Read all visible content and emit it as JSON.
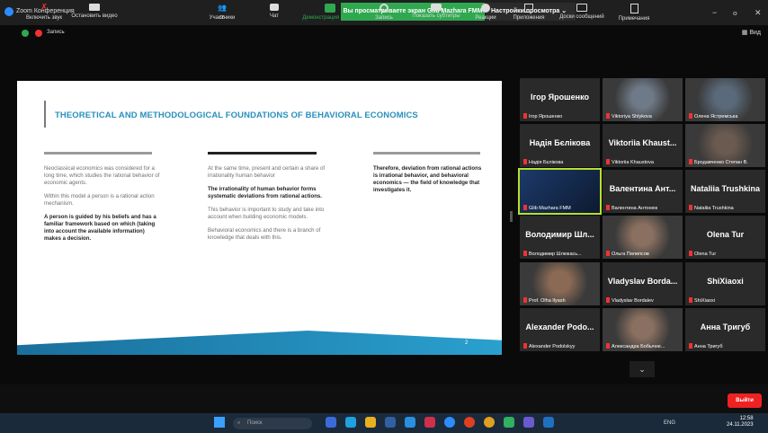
{
  "window": {
    "title": "Zoom Конференция",
    "share_banner": "Вы просматриваете экран Glib Mazhara FMM",
    "view_options": "Настройки просмотра",
    "minimize": "−",
    "maximize": "ⲟ",
    "close": "✕"
  },
  "status": {
    "recording": "Запись",
    "view": "Вид"
  },
  "slide": {
    "title": "THEORETICAL AND METHODOLOGICAL FOUNDATIONS OF BEHAVIORAL ECONOMICS",
    "col1": {
      "p1": "Neoclassical economics was considered for a long time, which studies the rational behavior of economic agents.",
      "p2": "Within this model a person is a rational action mechanism.",
      "p3": "A person is guided by his beliefs and has a familiar framework based on which (taking into account the available information) makes a decision."
    },
    "col2": {
      "p1": "At the same time, present and certain a share of irrationality human behavior",
      "p2": "The irrationality of human behavior forms systematic deviations from rational actions.",
      "p3": "This behavior is important to study and take into account when building economic models.",
      "p4": "Behavioral economics and there is a branch of knowledge that deals with this."
    },
    "col3": {
      "p1": "Therefore, deviation from rational actions is irrational behavior, and behavioral economics — the field of knowledge that investigates it."
    },
    "page": "2",
    "colors": {
      "title": "#2a8fbd",
      "bar_dark": "#222222",
      "bar_grey": "#9a9a9a",
      "stripe": "#1a6f9c"
    }
  },
  "participants": [
    {
      "name": "Ігор Ярошенко",
      "label": "Ігор Ярошенко",
      "video": false
    },
    {
      "name": "",
      "label": "Viktoriya Shlykova",
      "video": true
    },
    {
      "name": "",
      "label": "Олена Ястремська",
      "video": true
    },
    {
      "name": "Надія Бєлікова",
      "label": "Надія Бєлікова",
      "video": false
    },
    {
      "name": "Viktoriia Khaust...",
      "label": "Viktoriia Khaustova",
      "video": false
    },
    {
      "name": "",
      "label": "Бродавченко Степан В.",
      "video": true
    },
    {
      "name": "",
      "label": "Glib Mazhara FMM",
      "video": true,
      "active": true
    },
    {
      "name": "Валентина Ант...",
      "label": "Валентина Антонюк",
      "video": false
    },
    {
      "name": "Nataliia Trushkina",
      "label": "Nataliia Trushkina",
      "video": false
    },
    {
      "name": "Володимир Шл...",
      "label": "Володимир Шлюкась...",
      "video": false
    },
    {
      "name": "",
      "label": "Ольга Пилипсов",
      "video": true
    },
    {
      "name": "Olena Tur",
      "label": "Olena Tur",
      "video": false
    },
    {
      "name": "",
      "label": "Prof. Olha Ilyash",
      "video": true
    },
    {
      "name": "Vladyslav Borda...",
      "label": "Vladyslav Bordalev",
      "video": false
    },
    {
      "name": "ShiXiaoxi",
      "label": "ShiXiaoxi",
      "video": false
    },
    {
      "name": "Alexander Podo...",
      "label": "Alexander Podolskyy",
      "video": false
    },
    {
      "name": "",
      "label": "Александра Бобычне...",
      "video": true
    },
    {
      "name": "Анна Тригуб",
      "label": "Анна Тригуб",
      "video": false
    }
  ],
  "toolbar": {
    "unmute": "Включить звук",
    "start_video": "Остановить видео",
    "participants": "Участники",
    "participants_count": "68",
    "chat": "Чат",
    "share": "Демонстрация экрана",
    "record": "Запись",
    "captions": "Показать субтитры",
    "reactions": "Реакции",
    "apps": "Приложения",
    "whiteboards": "Доски сообщений",
    "notes": "Примечания",
    "leave": "Выйти"
  },
  "taskbar": {
    "search": "Поиск",
    "lang": "ENG",
    "time": "12:58",
    "date": "24.11.2023"
  }
}
